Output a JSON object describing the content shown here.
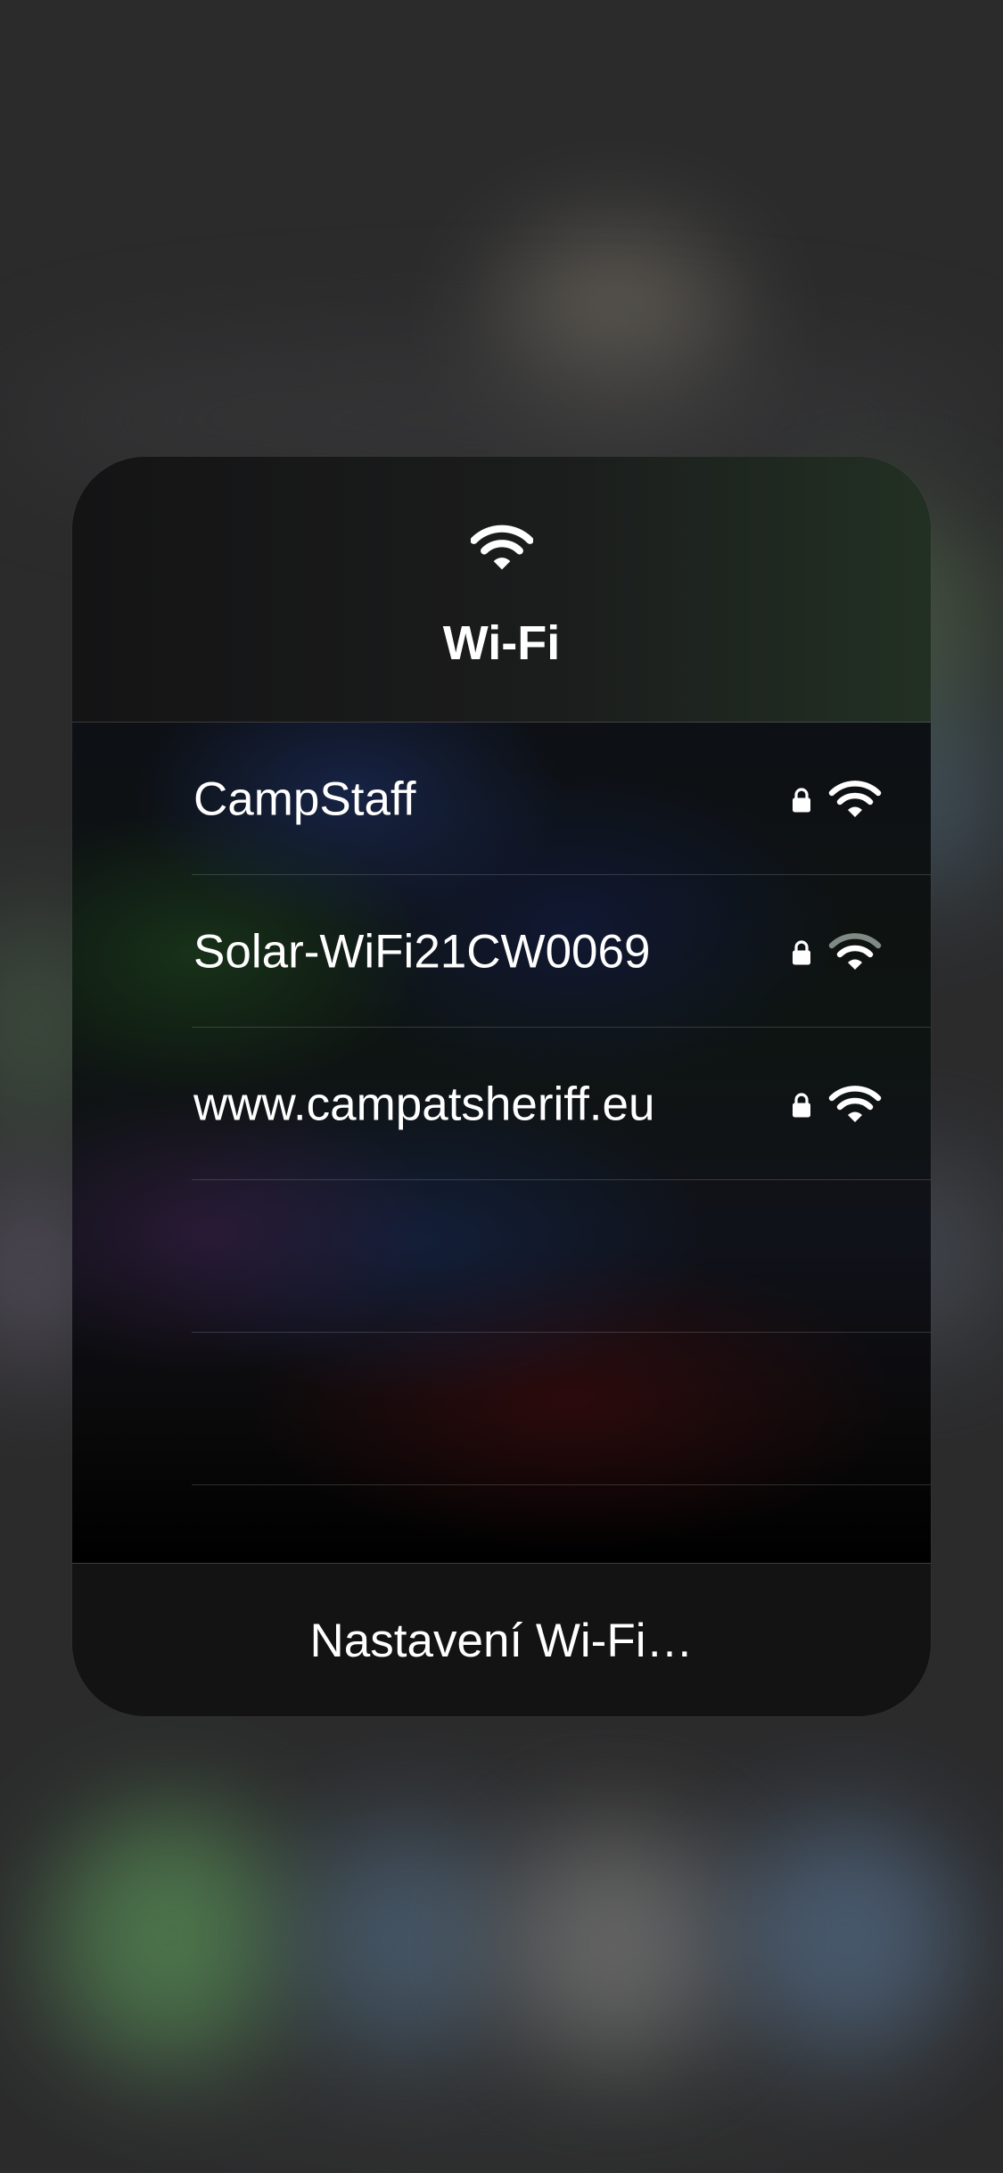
{
  "header": {
    "icon": "wifi-icon",
    "title": "Wi-Fi"
  },
  "networks": [
    {
      "name": "CampStaff",
      "secured": true,
      "signal_bars": 3,
      "signal_max": 3,
      "lock_icon": "lock-icon"
    },
    {
      "name": "Solar-WiFi21CW0069",
      "secured": true,
      "signal_bars": 2,
      "signal_max": 3,
      "lock_icon": "lock-icon"
    },
    {
      "name": "www.campatsheriff.eu",
      "secured": true,
      "signal_bars": 3,
      "signal_max": 3,
      "lock_icon": "lock-icon"
    }
  ],
  "footer": {
    "settings_label": "Nastavení Wi-Fi…"
  },
  "colors": {
    "text": "#ffffff",
    "signal_active": "#ffffff",
    "signal_inactive": "#7f8a84",
    "panel": "#171718"
  }
}
